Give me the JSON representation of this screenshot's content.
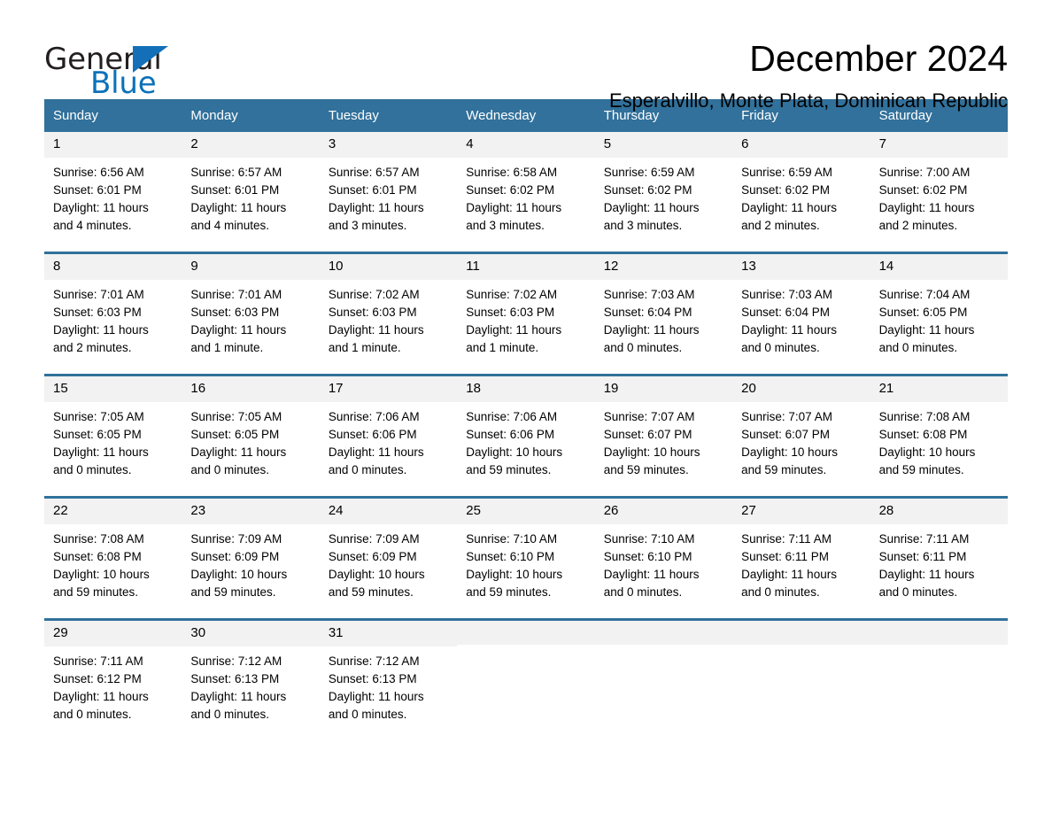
{
  "brand": {
    "name_part1": "General",
    "name_part2": "Blue"
  },
  "header": {
    "title": "December 2024",
    "subtitle": "Esperalvillo, Monte Plata, Dominican Republic"
  },
  "colors": {
    "header_blue": "#31719b",
    "brand_blue": "#0b72b9",
    "daynum_band": "#f2f2f2",
    "text": "#000000"
  },
  "weekdays": [
    "Sunday",
    "Monday",
    "Tuesday",
    "Wednesday",
    "Thursday",
    "Friday",
    "Saturday"
  ],
  "weeks": [
    [
      {
        "day": "1",
        "sunrise": "Sunrise: 6:56 AM",
        "sunset": "Sunset: 6:01 PM",
        "daylight_line1": "Daylight: 11 hours",
        "daylight_line2": "and 4 minutes."
      },
      {
        "day": "2",
        "sunrise": "Sunrise: 6:57 AM",
        "sunset": "Sunset: 6:01 PM",
        "daylight_line1": "Daylight: 11 hours",
        "daylight_line2": "and 4 minutes."
      },
      {
        "day": "3",
        "sunrise": "Sunrise: 6:57 AM",
        "sunset": "Sunset: 6:01 PM",
        "daylight_line1": "Daylight: 11 hours",
        "daylight_line2": "and 3 minutes."
      },
      {
        "day": "4",
        "sunrise": "Sunrise: 6:58 AM",
        "sunset": "Sunset: 6:02 PM",
        "daylight_line1": "Daylight: 11 hours",
        "daylight_line2": "and 3 minutes."
      },
      {
        "day": "5",
        "sunrise": "Sunrise: 6:59 AM",
        "sunset": "Sunset: 6:02 PM",
        "daylight_line1": "Daylight: 11 hours",
        "daylight_line2": "and 3 minutes."
      },
      {
        "day": "6",
        "sunrise": "Sunrise: 6:59 AM",
        "sunset": "Sunset: 6:02 PM",
        "daylight_line1": "Daylight: 11 hours",
        "daylight_line2": "and 2 minutes."
      },
      {
        "day": "7",
        "sunrise": "Sunrise: 7:00 AM",
        "sunset": "Sunset: 6:02 PM",
        "daylight_line1": "Daylight: 11 hours",
        "daylight_line2": "and 2 minutes."
      }
    ],
    [
      {
        "day": "8",
        "sunrise": "Sunrise: 7:01 AM",
        "sunset": "Sunset: 6:03 PM",
        "daylight_line1": "Daylight: 11 hours",
        "daylight_line2": "and 2 minutes."
      },
      {
        "day": "9",
        "sunrise": "Sunrise: 7:01 AM",
        "sunset": "Sunset: 6:03 PM",
        "daylight_line1": "Daylight: 11 hours",
        "daylight_line2": "and 1 minute."
      },
      {
        "day": "10",
        "sunrise": "Sunrise: 7:02 AM",
        "sunset": "Sunset: 6:03 PM",
        "daylight_line1": "Daylight: 11 hours",
        "daylight_line2": "and 1 minute."
      },
      {
        "day": "11",
        "sunrise": "Sunrise: 7:02 AM",
        "sunset": "Sunset: 6:03 PM",
        "daylight_line1": "Daylight: 11 hours",
        "daylight_line2": "and 1 minute."
      },
      {
        "day": "12",
        "sunrise": "Sunrise: 7:03 AM",
        "sunset": "Sunset: 6:04 PM",
        "daylight_line1": "Daylight: 11 hours",
        "daylight_line2": "and 0 minutes."
      },
      {
        "day": "13",
        "sunrise": "Sunrise: 7:03 AM",
        "sunset": "Sunset: 6:04 PM",
        "daylight_line1": "Daylight: 11 hours",
        "daylight_line2": "and 0 minutes."
      },
      {
        "day": "14",
        "sunrise": "Sunrise: 7:04 AM",
        "sunset": "Sunset: 6:05 PM",
        "daylight_line1": "Daylight: 11 hours",
        "daylight_line2": "and 0 minutes."
      }
    ],
    [
      {
        "day": "15",
        "sunrise": "Sunrise: 7:05 AM",
        "sunset": "Sunset: 6:05 PM",
        "daylight_line1": "Daylight: 11 hours",
        "daylight_line2": "and 0 minutes."
      },
      {
        "day": "16",
        "sunrise": "Sunrise: 7:05 AM",
        "sunset": "Sunset: 6:05 PM",
        "daylight_line1": "Daylight: 11 hours",
        "daylight_line2": "and 0 minutes."
      },
      {
        "day": "17",
        "sunrise": "Sunrise: 7:06 AM",
        "sunset": "Sunset: 6:06 PM",
        "daylight_line1": "Daylight: 11 hours",
        "daylight_line2": "and 0 minutes."
      },
      {
        "day": "18",
        "sunrise": "Sunrise: 7:06 AM",
        "sunset": "Sunset: 6:06 PM",
        "daylight_line1": "Daylight: 10 hours",
        "daylight_line2": "and 59 minutes."
      },
      {
        "day": "19",
        "sunrise": "Sunrise: 7:07 AM",
        "sunset": "Sunset: 6:07 PM",
        "daylight_line1": "Daylight: 10 hours",
        "daylight_line2": "and 59 minutes."
      },
      {
        "day": "20",
        "sunrise": "Sunrise: 7:07 AM",
        "sunset": "Sunset: 6:07 PM",
        "daylight_line1": "Daylight: 10 hours",
        "daylight_line2": "and 59 minutes."
      },
      {
        "day": "21",
        "sunrise": "Sunrise: 7:08 AM",
        "sunset": "Sunset: 6:08 PM",
        "daylight_line1": "Daylight: 10 hours",
        "daylight_line2": "and 59 minutes."
      }
    ],
    [
      {
        "day": "22",
        "sunrise": "Sunrise: 7:08 AM",
        "sunset": "Sunset: 6:08 PM",
        "daylight_line1": "Daylight: 10 hours",
        "daylight_line2": "and 59 minutes."
      },
      {
        "day": "23",
        "sunrise": "Sunrise: 7:09 AM",
        "sunset": "Sunset: 6:09 PM",
        "daylight_line1": "Daylight: 10 hours",
        "daylight_line2": "and 59 minutes."
      },
      {
        "day": "24",
        "sunrise": "Sunrise: 7:09 AM",
        "sunset": "Sunset: 6:09 PM",
        "daylight_line1": "Daylight: 10 hours",
        "daylight_line2": "and 59 minutes."
      },
      {
        "day": "25",
        "sunrise": "Sunrise: 7:10 AM",
        "sunset": "Sunset: 6:10 PM",
        "daylight_line1": "Daylight: 10 hours",
        "daylight_line2": "and 59 minutes."
      },
      {
        "day": "26",
        "sunrise": "Sunrise: 7:10 AM",
        "sunset": "Sunset: 6:10 PM",
        "daylight_line1": "Daylight: 11 hours",
        "daylight_line2": "and 0 minutes."
      },
      {
        "day": "27",
        "sunrise": "Sunrise: 7:11 AM",
        "sunset": "Sunset: 6:11 PM",
        "daylight_line1": "Daylight: 11 hours",
        "daylight_line2": "and 0 minutes."
      },
      {
        "day": "28",
        "sunrise": "Sunrise: 7:11 AM",
        "sunset": "Sunset: 6:11 PM",
        "daylight_line1": "Daylight: 11 hours",
        "daylight_line2": "and 0 minutes."
      }
    ],
    [
      {
        "day": "29",
        "sunrise": "Sunrise: 7:11 AM",
        "sunset": "Sunset: 6:12 PM",
        "daylight_line1": "Daylight: 11 hours",
        "daylight_line2": "and 0 minutes."
      },
      {
        "day": "30",
        "sunrise": "Sunrise: 7:12 AM",
        "sunset": "Sunset: 6:13 PM",
        "daylight_line1": "Daylight: 11 hours",
        "daylight_line2": "and 0 minutes."
      },
      {
        "day": "31",
        "sunrise": "Sunrise: 7:12 AM",
        "sunset": "Sunset: 6:13 PM",
        "daylight_line1": "Daylight: 11 hours",
        "daylight_line2": "and 0 minutes."
      },
      {
        "day": "",
        "sunrise": "",
        "sunset": "",
        "daylight_line1": "",
        "daylight_line2": ""
      },
      {
        "day": "",
        "sunrise": "",
        "sunset": "",
        "daylight_line1": "",
        "daylight_line2": ""
      },
      {
        "day": "",
        "sunrise": "",
        "sunset": "",
        "daylight_line1": "",
        "daylight_line2": ""
      },
      {
        "day": "",
        "sunrise": "",
        "sunset": "",
        "daylight_line1": "",
        "daylight_line2": ""
      }
    ]
  ]
}
